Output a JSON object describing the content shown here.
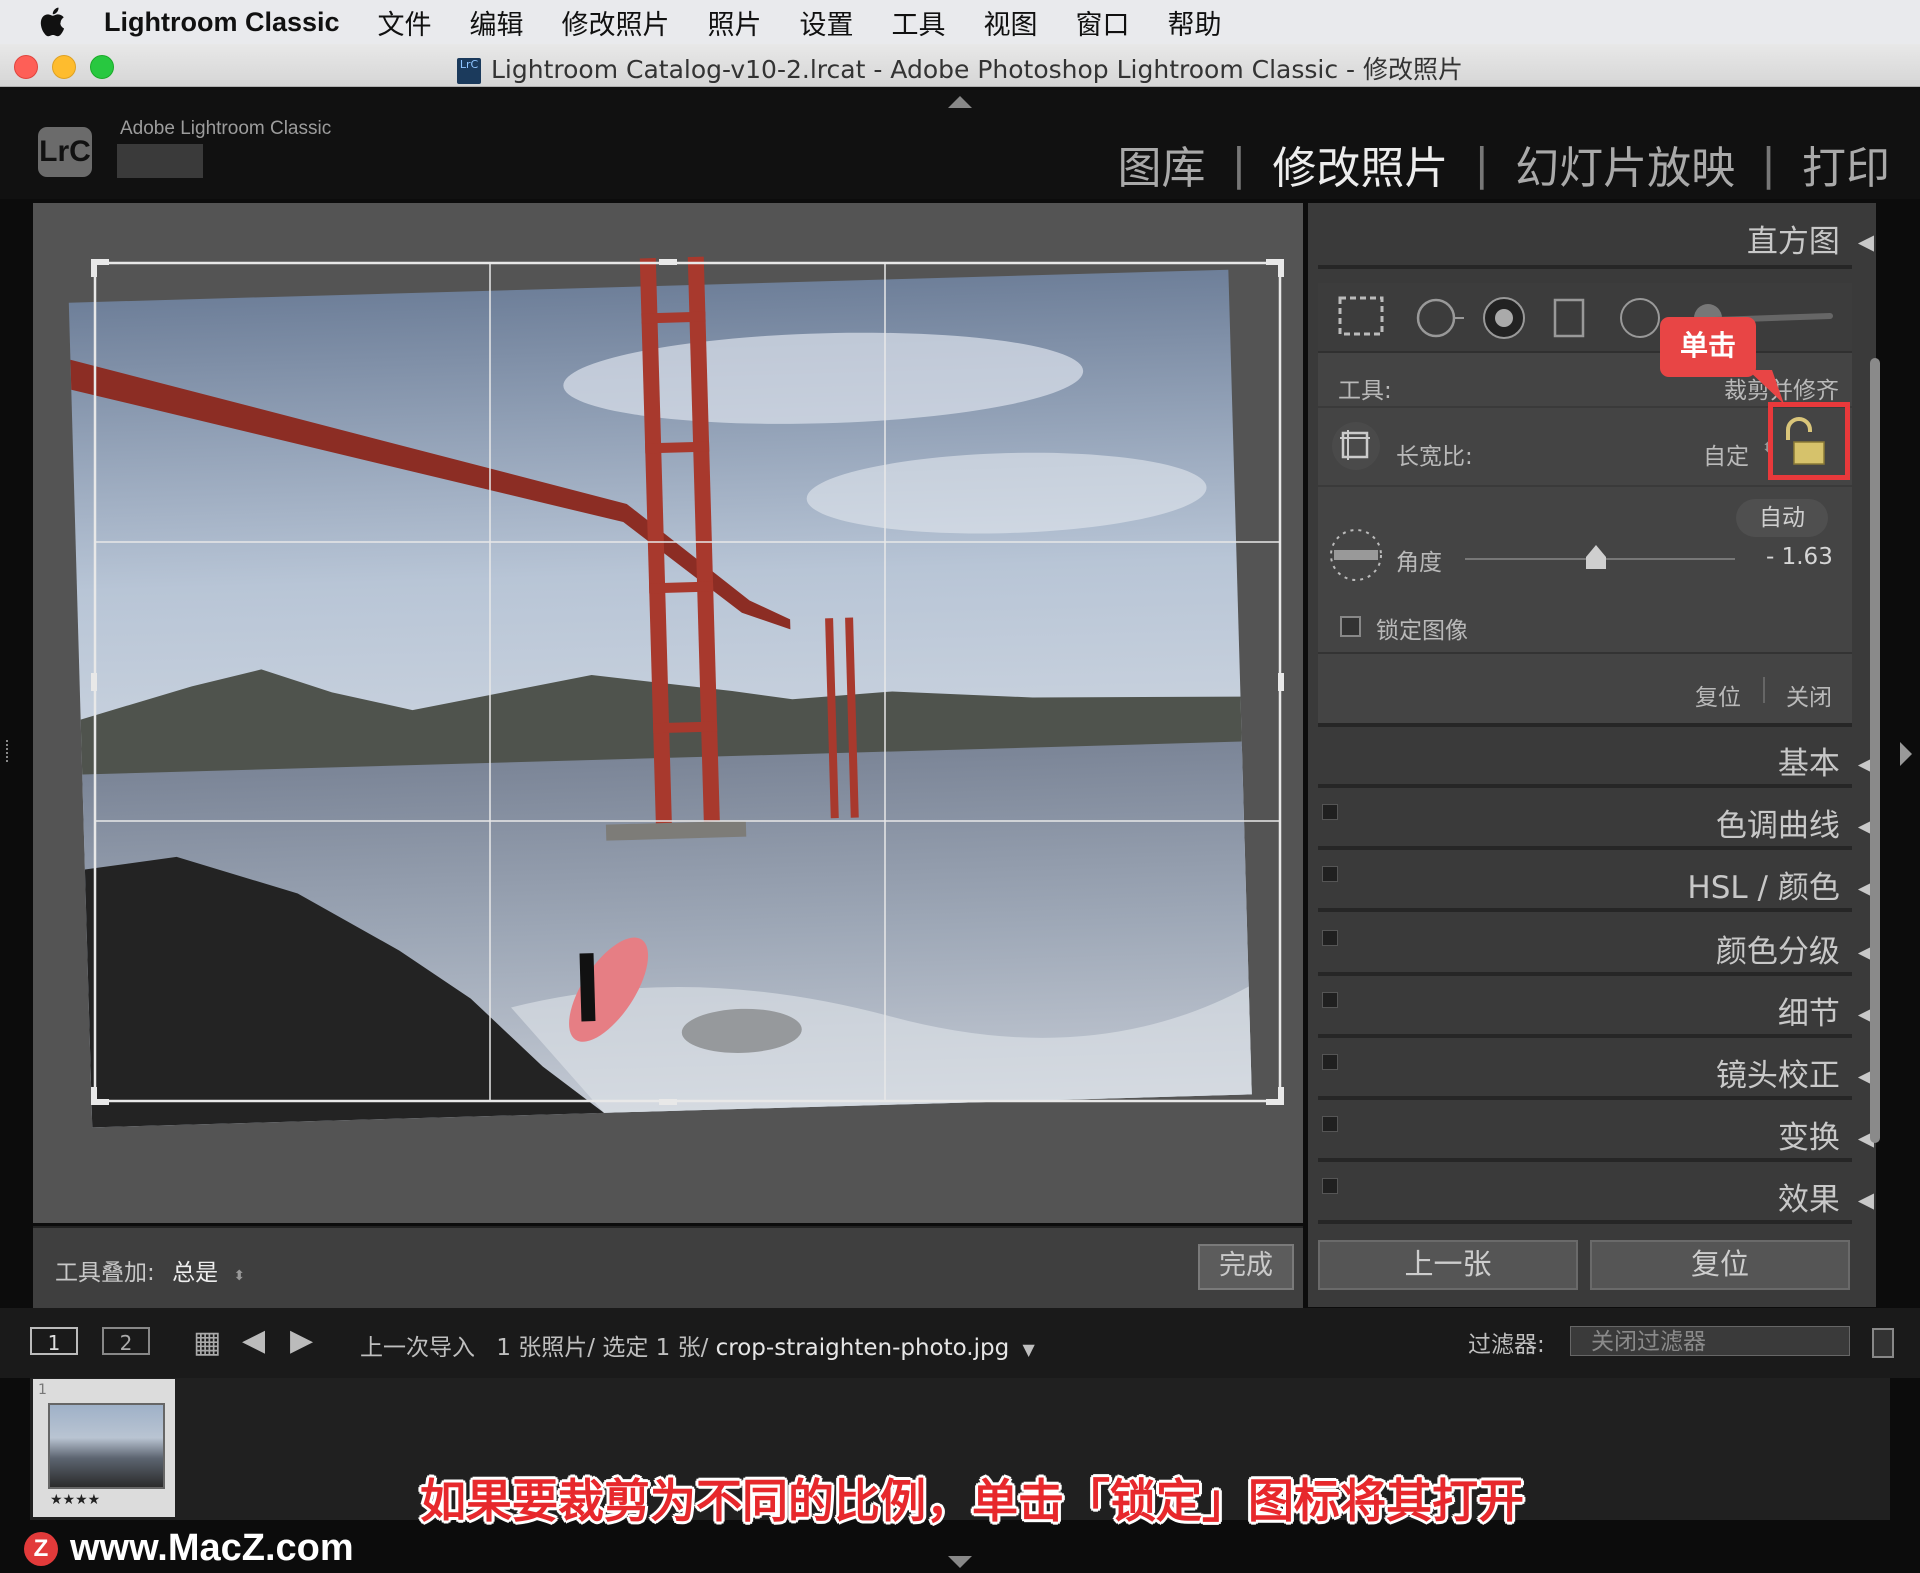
{
  "menubar": {
    "app_name": "Lightroom Classic",
    "items": [
      "文件",
      "编辑",
      "修改照片",
      "照片",
      "设置",
      "工具",
      "视图",
      "窗口",
      "帮助"
    ]
  },
  "window": {
    "title": "Lightroom Catalog-v10-2.lrcat - Adobe Photoshop Lightroom Classic - 修改照片",
    "doc_icon_text": "LrC"
  },
  "identity": {
    "logo_text": "LrC",
    "app_label": "Adobe Lightroom Classic"
  },
  "modules": {
    "library": "图库",
    "develop": "修改照片",
    "slideshow": "幻灯片放映",
    "print": "打印",
    "separator": "|"
  },
  "toolbar": {
    "overlay_label": "工具叠加:",
    "overlay_value": "总是",
    "done_label": "完成"
  },
  "right_panel": {
    "histogram_label": "直方图",
    "crop": {
      "tool_label": "工具:",
      "tool_value": "裁剪并修齐",
      "aspect_label": "长宽比:",
      "aspect_value": "自定",
      "auto_label": "自动",
      "angle_label": "角度",
      "angle_value": "- 1.63",
      "lock_image_label": "锁定图像",
      "reset_label": "复位",
      "close_label": "关闭"
    },
    "sections": [
      "基本",
      "色调曲线",
      "HSL / 颜色",
      "颜色分级",
      "细节",
      "镜头校正",
      "变换",
      "效果"
    ],
    "prev_button": "上一张",
    "reset_button": "复位"
  },
  "callout": {
    "text": "单击",
    "color": "#e84545"
  },
  "filmstrip_bar": {
    "view1": "1",
    "view2": "2",
    "source": "上一次导入",
    "count": "1 张照片/ 选定 1 张/",
    "filename": "crop-straighten-photo.jpg",
    "filter_label": "过滤器:",
    "filter_value": "关闭过滤器"
  },
  "thumbnail": {
    "index": "1",
    "rating": "★★★★"
  },
  "caption": "如果要裁剪为不同的比例，单击「锁定」图标将其打开",
  "watermark": {
    "logo": "Z",
    "text": "www.MacZ.com"
  },
  "colors": {
    "highlight": "#e8393b",
    "bridge": "#b43a2e",
    "sky": "#9fb3cc"
  }
}
